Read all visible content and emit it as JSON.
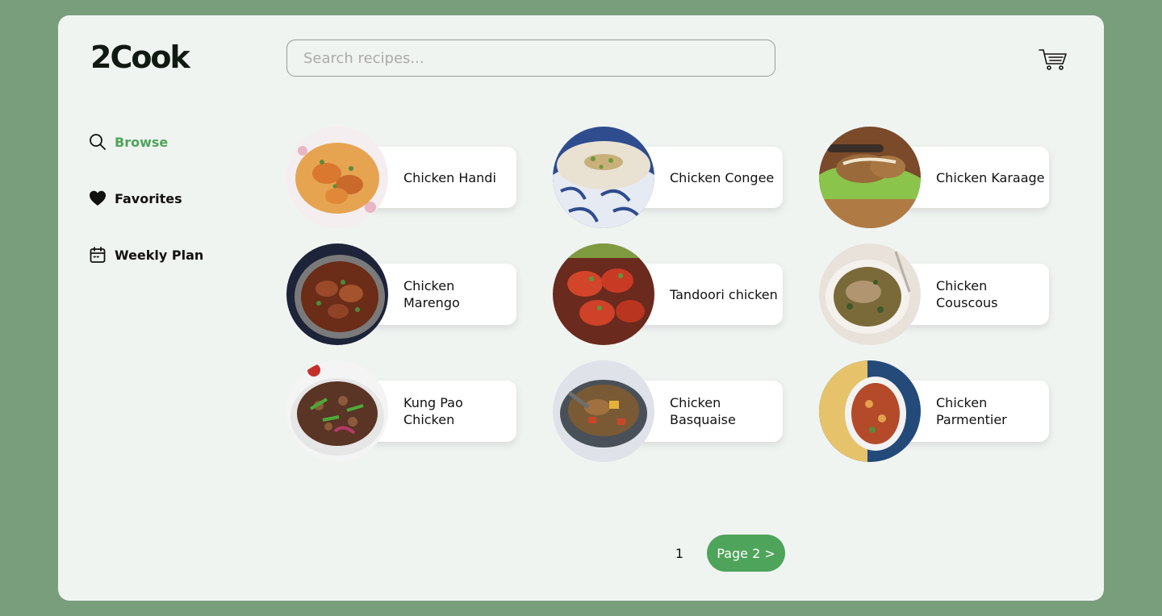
{
  "app": {
    "logo": "2Cook"
  },
  "search": {
    "placeholder": "Search recipes..."
  },
  "nav": {
    "items": [
      {
        "label": "Browse",
        "icon": "search-icon",
        "active": true
      },
      {
        "label": "Favorites",
        "icon": "heart-icon",
        "active": false
      },
      {
        "label": "Weekly Plan",
        "icon": "calendar-icon",
        "active": false
      }
    ]
  },
  "recipes": [
    {
      "title": "Chicken Handi",
      "image": "chicken-handi-photo"
    },
    {
      "title": "Chicken Congee",
      "image": "chicken-congee-photo"
    },
    {
      "title": "Chicken Karaage",
      "image": "chicken-karaage-photo"
    },
    {
      "title": "Chicken Marengo",
      "image": "chicken-marengo-photo"
    },
    {
      "title": "Tandoori chicken",
      "image": "tandoori-chicken-photo"
    },
    {
      "title": "Chicken Couscous",
      "image": "chicken-couscous-photo"
    },
    {
      "title": "Kung Pao Chicken",
      "image": "kung-pao-chicken-photo"
    },
    {
      "title": "Chicken Basquaise",
      "image": "chicken-basquaise-photo"
    },
    {
      "title": "Chicken Parmentier",
      "image": "chicken-parmentier-photo"
    }
  ],
  "pagination": {
    "current": "1",
    "next_label": "Page 2 >"
  },
  "colors": {
    "accent": "#4ea45a",
    "background": "#799e7c",
    "panel": "#f0f4f1"
  }
}
